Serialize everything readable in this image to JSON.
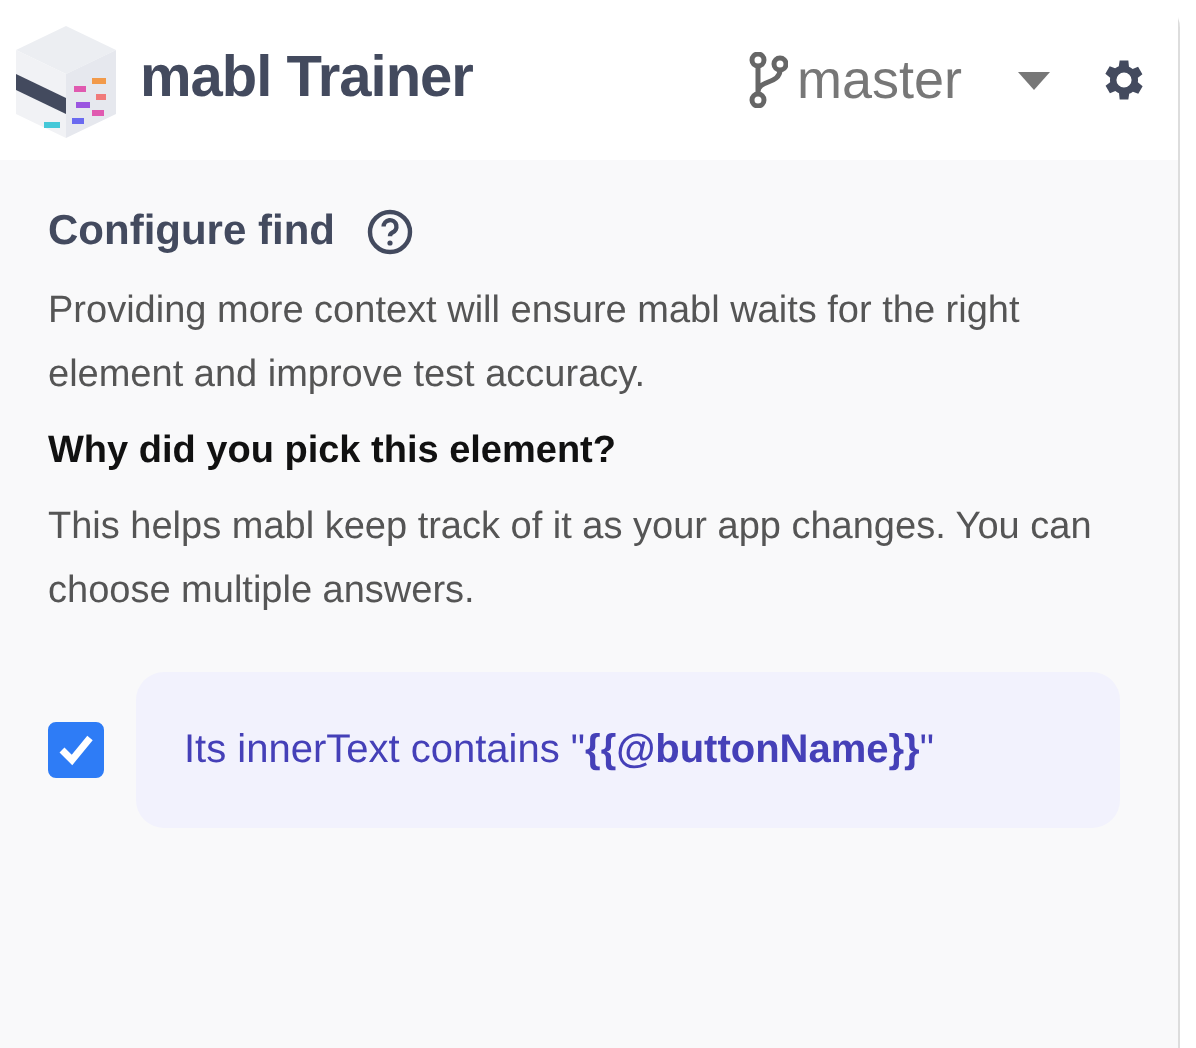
{
  "header": {
    "title": "mabl Trainer",
    "branch": "master"
  },
  "section": {
    "title": "Configure find",
    "description": "Providing more context will ensure mabl waits for the right element and improve test accuracy.",
    "question": "Why did you pick this element?",
    "hint": "This helps mabl keep track of it as your app changes. You can choose multiple answers."
  },
  "options": [
    {
      "text": "Its innerText contains \"**{{@buttonName}}**\"",
      "checked": true
    }
  ]
}
